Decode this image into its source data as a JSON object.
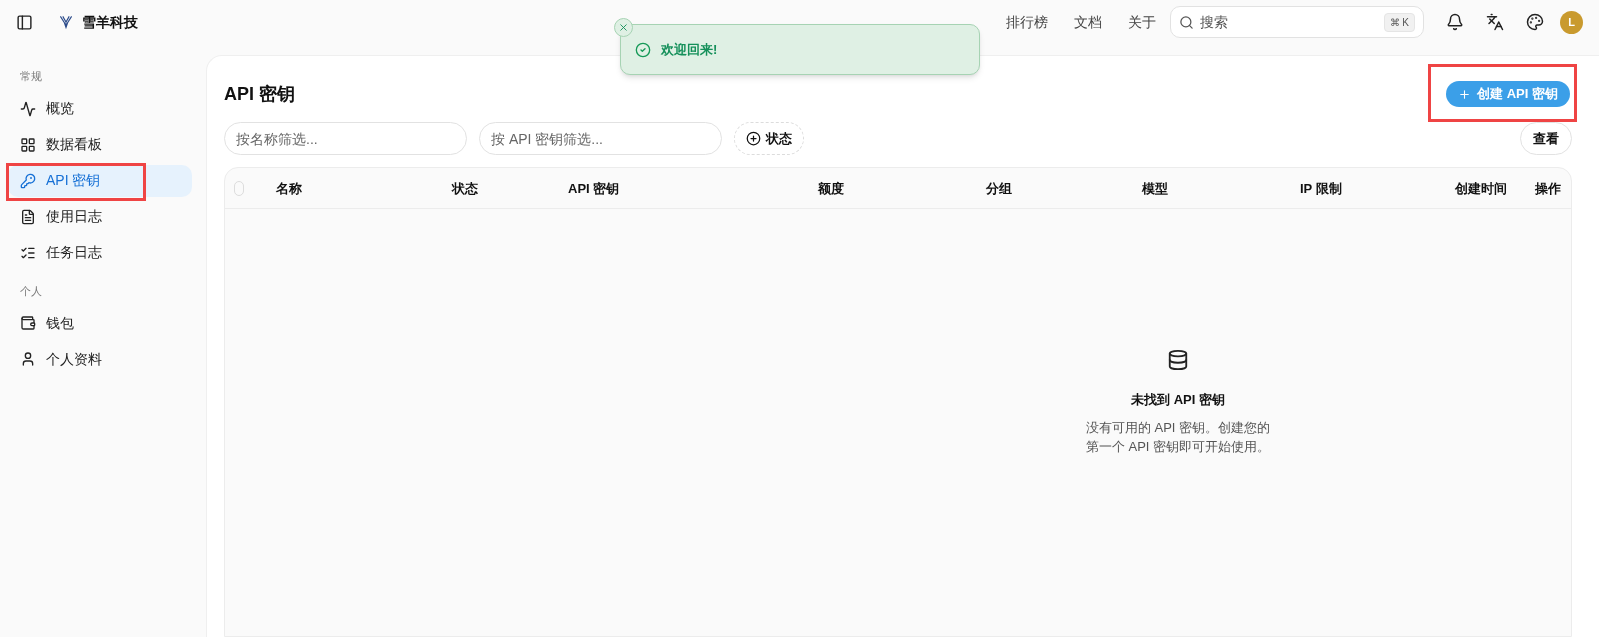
{
  "header": {
    "brand": "雪羊科技",
    "nav": [
      {
        "label": "排行榜",
        "selected": false
      },
      {
        "label": "文档",
        "selected": false
      },
      {
        "label": "关于",
        "selected": false
      }
    ],
    "search": {
      "placeholder": "搜索",
      "shortcut": "⌘ K"
    },
    "avatar": "L"
  },
  "toast": {
    "message": "欢迎回来!"
  },
  "sidebar": {
    "sections": [
      {
        "title": "常规",
        "items": [
          {
            "label": "概览",
            "selected": false,
            "highlighted": false
          },
          {
            "label": "数据看板",
            "selected": false,
            "highlighted": false
          },
          {
            "label": "API 密钥",
            "selected": true,
            "highlighted": true
          },
          {
            "label": "使用日志",
            "selected": false,
            "highlighted": false
          },
          {
            "label": "任务日志",
            "selected": false,
            "highlighted": false
          }
        ]
      },
      {
        "title": "个人",
        "items": [
          {
            "label": "钱包",
            "selected": false,
            "highlighted": false
          },
          {
            "label": "个人资料",
            "selected": false,
            "highlighted": false
          }
        ]
      }
    ]
  },
  "page": {
    "title": "API 密钥",
    "create_button": {
      "label": "创建 API 密钥",
      "highlighted": true
    },
    "filters": [
      {
        "placeholder": "按名称筛选..."
      },
      {
        "placeholder": "按 API 密钥筛选..."
      }
    ],
    "status_filter": "状态",
    "view_button": "查看",
    "table": {
      "columns": [
        "名称",
        "状态",
        "API 密钥",
        "额度",
        "分组",
        "模型",
        "IP 限制",
        "创建时间",
        "操作"
      ],
      "select_all": {
        "checked": false
      }
    },
    "empty": {
      "title": "未找到 API 密钥",
      "lines": [
        "没有可用的 API 密钥。创建您的",
        "第一个 API 密钥即可开始使用。"
      ]
    }
  }
}
